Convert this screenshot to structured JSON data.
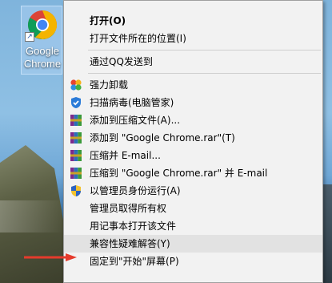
{
  "desktop": {
    "icon_label": "Google\nChrome"
  },
  "menu": {
    "items": [
      {
        "label": "打开(O)",
        "bold": true,
        "icon": ""
      },
      {
        "label": "打开文件所在的位置(I)",
        "icon": ""
      },
      {
        "separator": true
      },
      {
        "label": "通过QQ发送到",
        "icon": ""
      },
      {
        "separator": true
      },
      {
        "label": "强力卸载",
        "icon": "clover-uninstall-icon"
      },
      {
        "label": "扫描病毒(电脑管家)",
        "icon": "shield-scan-icon"
      },
      {
        "label": "添加到压缩文件(A)...",
        "icon": "winrar-archive-icon"
      },
      {
        "label": "添加到 \"Google Chrome.rar\"(T)",
        "icon": "winrar-archive-icon"
      },
      {
        "label": "压缩并 E-mail...",
        "icon": "winrar-archive-icon"
      },
      {
        "label": "压缩到 \"Google Chrome.rar\" 并 E-mail",
        "icon": "winrar-archive-icon"
      },
      {
        "label": "以管理员身份运行(A)",
        "icon": "uac-shield-icon"
      },
      {
        "label": "管理员取得所有权",
        "icon": ""
      },
      {
        "label": "用记事本打开该文件",
        "icon": ""
      },
      {
        "label": "兼容性疑难解答(Y)",
        "icon": "",
        "highlighted": true
      },
      {
        "label": "固定到\"开始\"屏幕(P)",
        "icon": ""
      }
    ]
  },
  "colors": {
    "menu_bg": "#f2f2f2",
    "highlight": "#e2e2e2",
    "arrow": "#e53b2c"
  }
}
